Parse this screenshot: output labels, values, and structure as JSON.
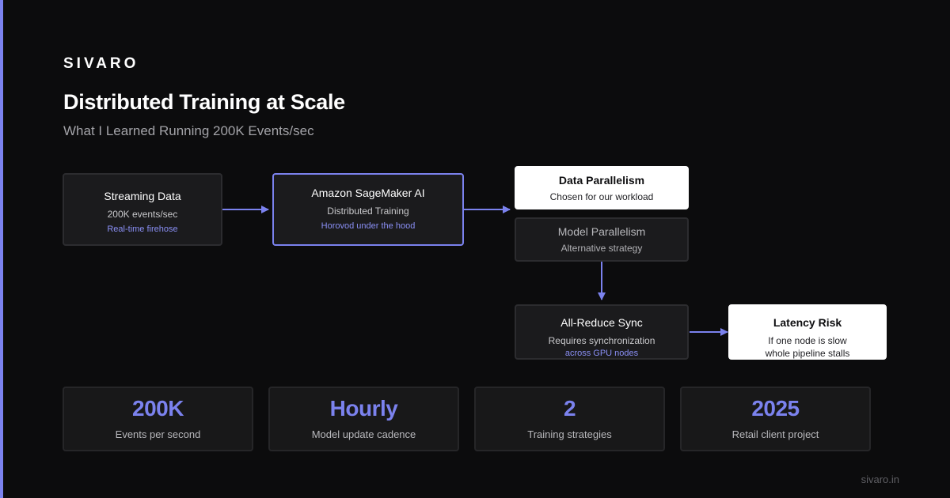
{
  "brand": "SIVARO",
  "title": "Distributed Training at Scale",
  "subtitle": "What I Learned Running 200K Events/sec",
  "nodes": {
    "streaming": {
      "title": "Streaming Data",
      "sub": "200K events/sec",
      "accent": "Real-time firehose"
    },
    "sagemaker": {
      "title": "Amazon SageMaker AI",
      "sub": "Distributed Training",
      "accent": "Horovod under the hood"
    },
    "data_parallel": {
      "title": "Data Parallelism",
      "sub": "Chosen for our workload"
    },
    "model_parallel": {
      "title": "Model Parallelism",
      "sub": "Alternative strategy"
    },
    "allreduce": {
      "title": "All-Reduce Sync",
      "sub": "Requires synchronization",
      "accent": "across GPU nodes"
    },
    "latency": {
      "title": "Latency Risk",
      "line1": "If one node is slow",
      "line2": "whole pipeline stalls"
    }
  },
  "stats": [
    {
      "value": "200K",
      "label": "Events per second"
    },
    {
      "value": "Hourly",
      "label": "Model update cadence"
    },
    {
      "value": "2",
      "label": "Training strategies"
    },
    {
      "value": "2025",
      "label": "Retail client project"
    }
  ],
  "footer": "sivaro.in",
  "colors": {
    "accent": "#7b82ee",
    "background": "#0c0c0d",
    "card": "#1b1b1d"
  }
}
